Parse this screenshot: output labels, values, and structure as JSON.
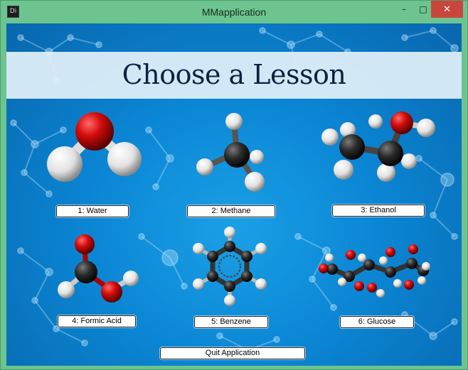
{
  "window": {
    "title": "MMapplication",
    "app_icon_text": "Di",
    "minimize_glyph": "–",
    "maximize_glyph": "□",
    "close_glyph": "✕"
  },
  "heading": "Choose a Lesson",
  "lessons": [
    {
      "label": "1: Water"
    },
    {
      "label": "2: Methane"
    },
    {
      "label": "3: Ethanol"
    },
    {
      "label": "4: Formic Acid"
    },
    {
      "label": "5: Benzene"
    },
    {
      "label": "6: Glucose"
    }
  ],
  "quit_label": "Quit Application",
  "colors": {
    "title_bar": "#6cc48f",
    "close_button": "#c9463d",
    "background_blue": "#0b86d4",
    "oxygen": "#d50c0c",
    "carbon": "#2a2a2a",
    "hydrogen": "#f2f2f2"
  }
}
